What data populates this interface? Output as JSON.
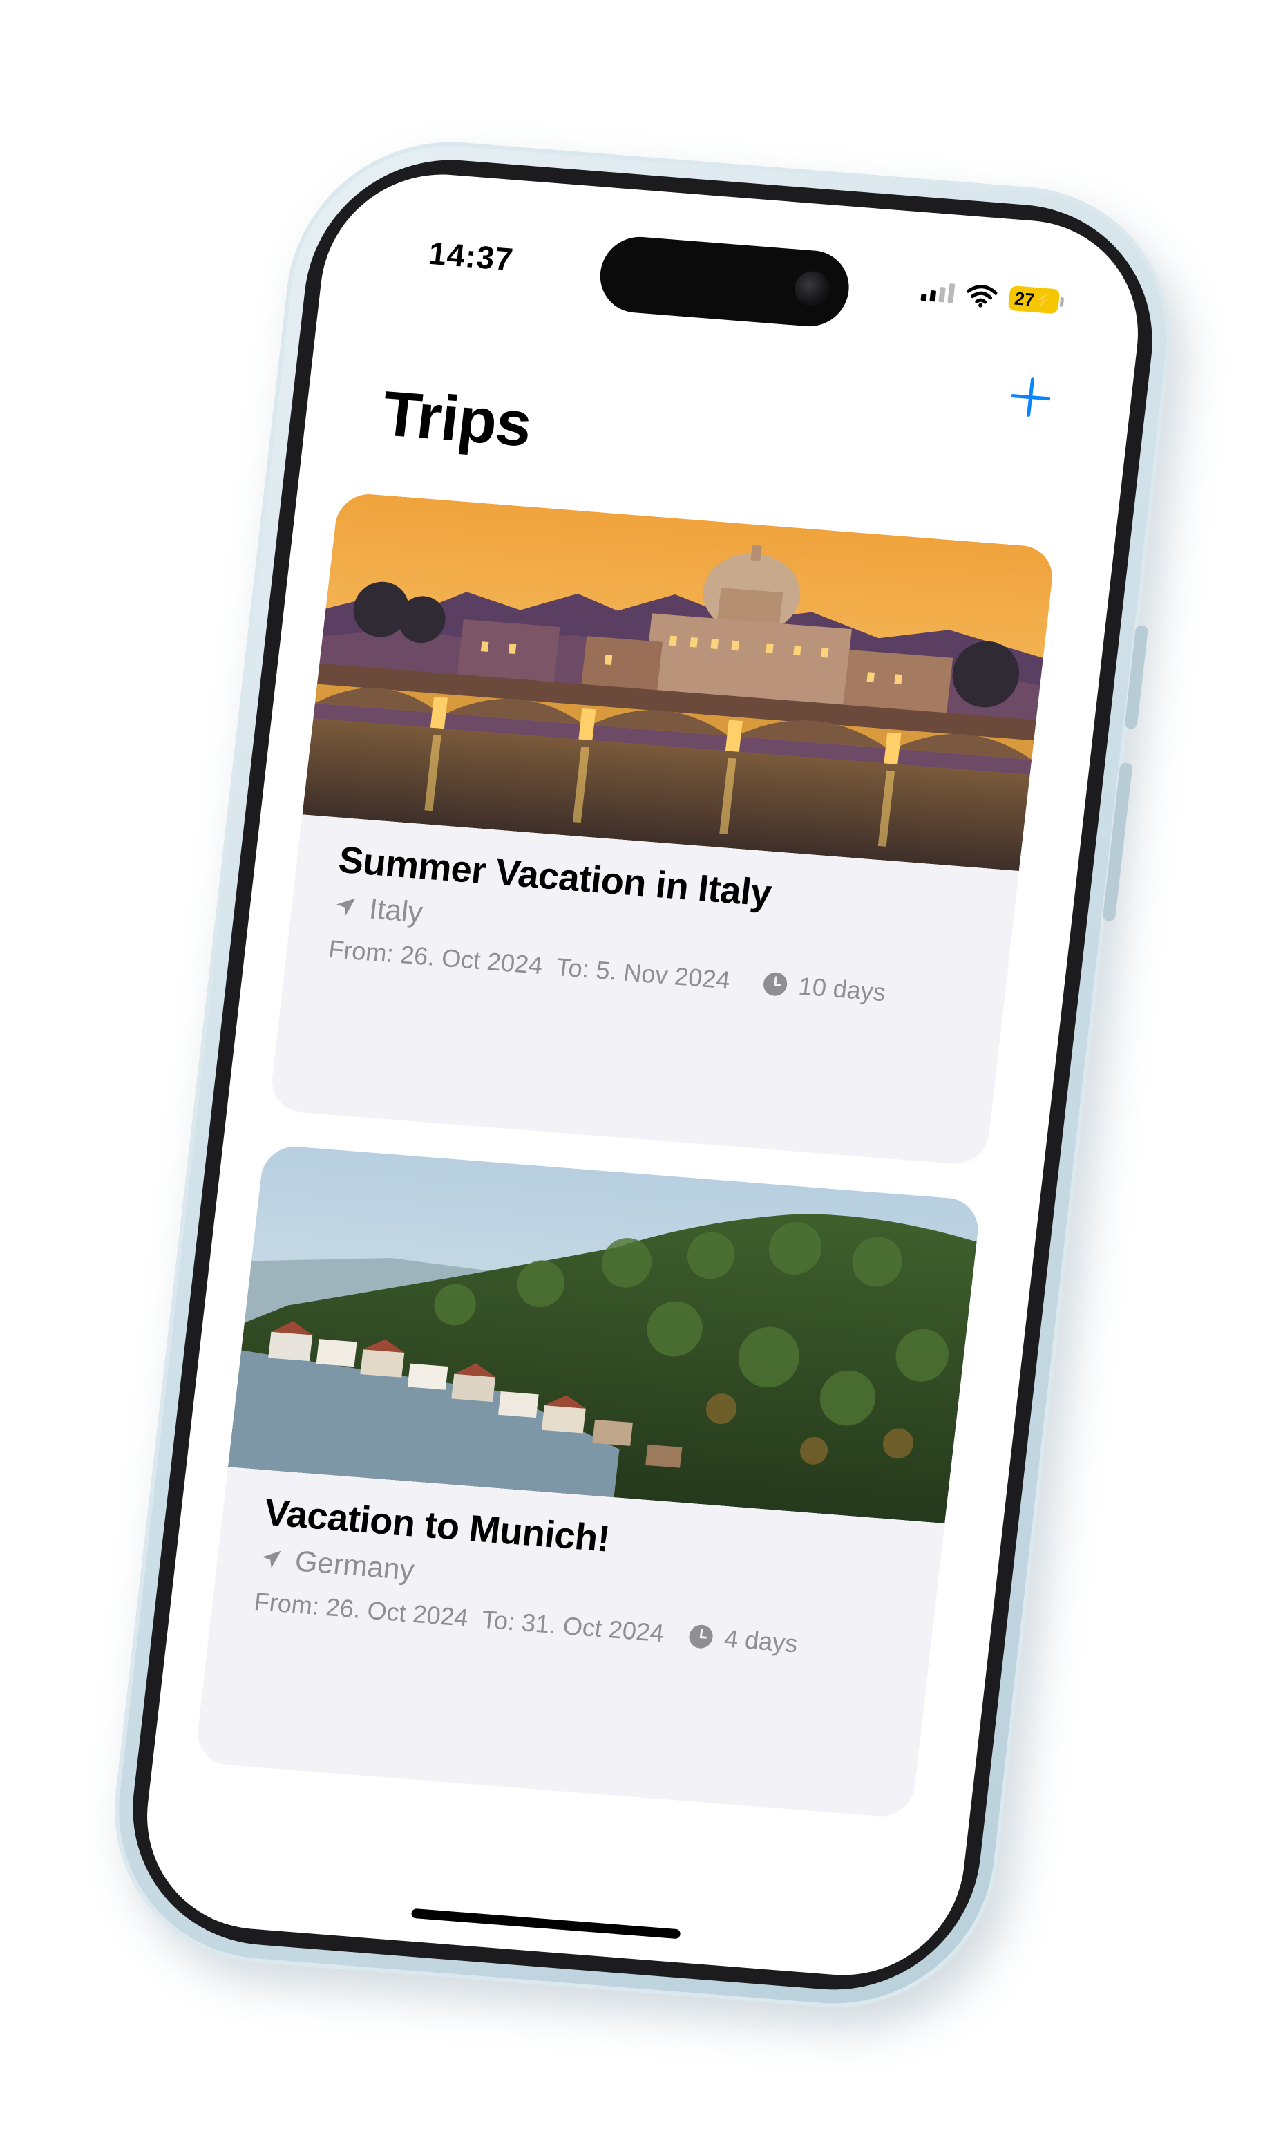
{
  "status_bar": {
    "time": "14:37",
    "battery": "27",
    "icons": [
      "cellular-signal-icon",
      "wifi-icon",
      "battery-charging-icon"
    ]
  },
  "header": {
    "title": "Trips",
    "add_icon": "plus-icon"
  },
  "trips": [
    {
      "title": "Summer Vacation in Italy",
      "location": "Italy",
      "from": "From: 26. Oct 2024",
      "to": "To: 5. Nov 2024",
      "duration": "10 days"
    },
    {
      "title": "Vacation to Munich!",
      "location": "Germany",
      "from": "From: 26. Oct 2024",
      "to": "To: 31. Oct 2024",
      "duration": "4 days"
    }
  ],
  "colors": {
    "accent": "#0a84ff",
    "card_background": "#f2f2f7",
    "secondary_text": "#8e8e93",
    "battery": "#f6c700",
    "phone_frame": "#cfe0e8"
  }
}
